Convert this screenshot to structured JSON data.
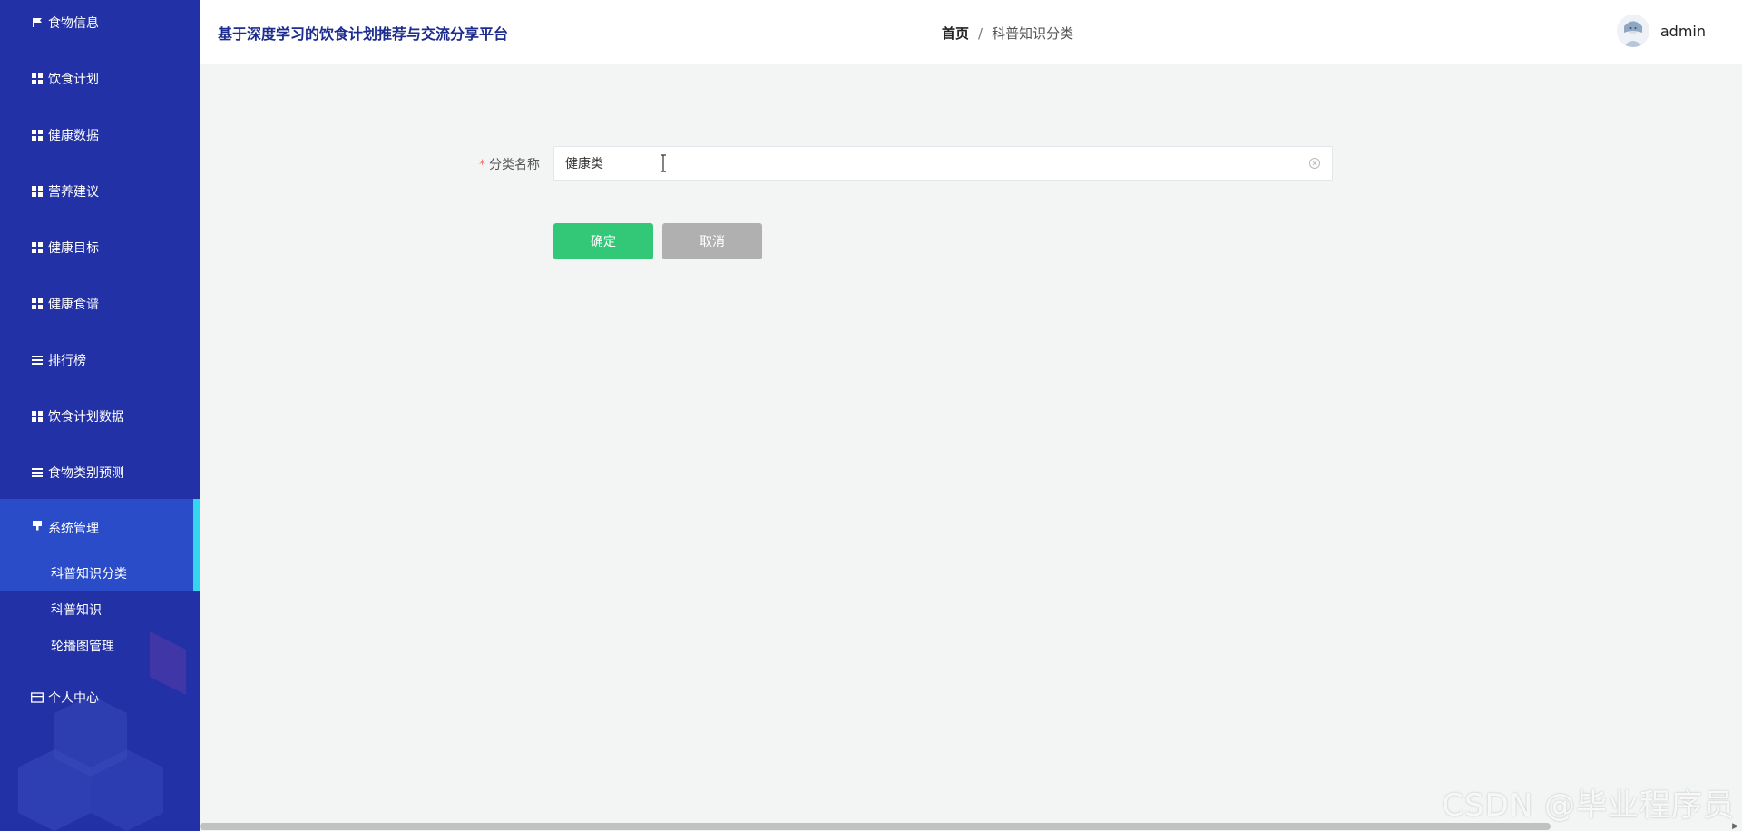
{
  "app": {
    "title": "基于深度学习的饮食计划推荐与交流分享平台"
  },
  "breadcrumb": {
    "home": "首页",
    "separator": "/",
    "current": "科普知识分类"
  },
  "user": {
    "name": "admin",
    "avatar_icon": "avatar-icon"
  },
  "sidebar": {
    "items": [
      {
        "label": "食物信息",
        "icon": "flag-icon"
      },
      {
        "label": "饮食计划",
        "icon": "grid-icon"
      },
      {
        "label": "健康数据",
        "icon": "grid-icon"
      },
      {
        "label": "营养建议",
        "icon": "grid-icon"
      },
      {
        "label": "健康目标",
        "icon": "grid-icon"
      },
      {
        "label": "健康食谱",
        "icon": "grid-icon"
      },
      {
        "label": "排行榜",
        "icon": "list-icon"
      },
      {
        "label": "饮食计划数据",
        "icon": "grid-icon"
      },
      {
        "label": "食物类别预测",
        "icon": "list-icon"
      },
      {
        "label": "系统管理",
        "icon": "settings-icon"
      },
      {
        "label": "个人中心",
        "icon": "card-icon"
      }
    ],
    "system_sub": [
      {
        "label": "科普知识分类",
        "active": true
      },
      {
        "label": "科普知识",
        "active": false
      },
      {
        "label": "轮播图管理",
        "active": false
      }
    ]
  },
  "form": {
    "required_mark": "*",
    "category_label": "分类名称",
    "category_value": "健康类",
    "confirm_label": "确定",
    "cancel_label": "取消"
  },
  "colors": {
    "sidebar_bg": "#2231a6",
    "active_bg": "#2a4cc8",
    "active_accent": "#33d6f0",
    "confirm": "#33c878",
    "cancel": "#b0b0b0",
    "title": "#1d2d8f"
  },
  "watermark": "CSDN @毕业程序员"
}
